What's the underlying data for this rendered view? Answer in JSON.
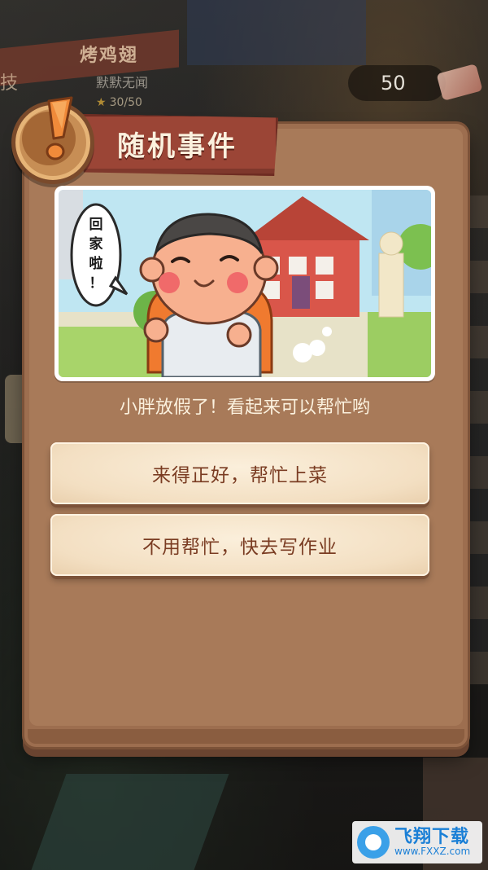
{
  "background": {
    "shop_name": "烤鸡翅",
    "shop_left_char": "技",
    "player_subtitle": "默默无闻",
    "star_progress": "30/50",
    "coins": "50"
  },
  "modal": {
    "title": "随机事件",
    "title_icon": "exclamation-icon",
    "illustration": {
      "speech_bubble": [
        "回",
        "家",
        "啦",
        "！"
      ]
    },
    "description": "小胖放假了！看起来可以帮忙哟",
    "options": [
      {
        "label": "来得正好，帮忙上菜"
      },
      {
        "label": "不用帮忙，快去写作业"
      }
    ]
  },
  "watermark": {
    "title": "飞翔下载",
    "url": "www.FXXZ.com"
  },
  "colors": {
    "modal_bg": "#a87a59",
    "ribbon": "#9b4536",
    "option_text": "#7a3c22",
    "text_light": "#fbf1de"
  }
}
